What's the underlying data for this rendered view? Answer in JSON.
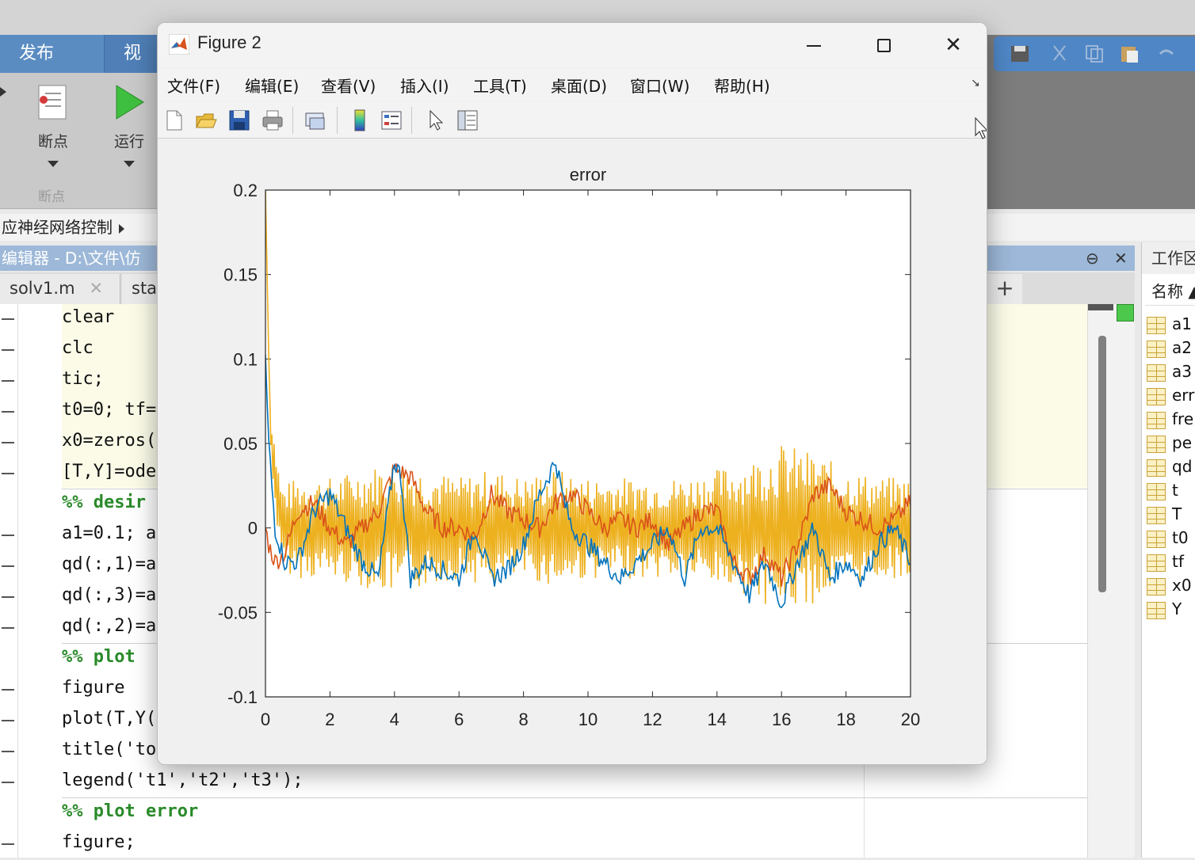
{
  "desktop": {
    "ribbon_tabs": [
      "发布",
      "视"
    ],
    "ribbon_buttons": [
      {
        "label": "断点",
        "icon": "breakpoint-icon"
      },
      {
        "label": "运行",
        "icon": "run-icon"
      }
    ],
    "ribbon_section": "断点",
    "breadcrumb": "应神经网络控制",
    "editor_title": "编辑器 - D:\\文件\\仿",
    "editor_tabs": [
      "solv1.m",
      "sta"
    ],
    "editor_lines": [
      {
        "text": "clear",
        "type": "code",
        "dash": true
      },
      {
        "text": "clc",
        "type": "code",
        "dash": true
      },
      {
        "text": "tic;",
        "type": "code",
        "dash": true
      },
      {
        "text": "t0=0; tf=",
        "type": "code",
        "dash": true
      },
      {
        "text": "x0=zeros(",
        "type": "code",
        "dash": true
      },
      {
        "text": "[T,Y]=ode",
        "type": "code",
        "dash": true
      },
      {
        "text": "%% desir",
        "type": "comment",
        "dash": false
      },
      {
        "text": "a1=0.1; a",
        "type": "code",
        "dash": true
      },
      {
        "text": "qd(:,1)=a",
        "type": "code",
        "dash": true
      },
      {
        "text": "qd(:,3)=a",
        "type": "code",
        "dash": true
      },
      {
        "text": "qd(:,2)=a",
        "type": "code",
        "dash": true
      },
      {
        "text": "%% plot",
        "type": "comment",
        "dash": false
      },
      {
        "text": "figure",
        "type": "code",
        "dash": true
      },
      {
        "text": "plot(T,Y(",
        "type": "code",
        "dash": true
      },
      {
        "text": "title('to",
        "type": "code",
        "dash": true
      },
      {
        "text": "legend('t1','t2','t3');",
        "type": "code",
        "dash": true
      },
      {
        "text": "%% plot error",
        "type": "comment",
        "dash": false
      },
      {
        "text": "figure;",
        "type": "code",
        "dash": true
      }
    ],
    "workspace_title": "工作区",
    "workspace_header": "名称 ▲",
    "workspace_vars": [
      "a1",
      "a2",
      "a3",
      "err",
      "fre",
      "pe",
      "qd",
      "t",
      "T",
      "t0",
      "tf",
      "x0",
      "Y"
    ]
  },
  "figure": {
    "title": "Figure 2",
    "menu": [
      "文件(F)",
      "编辑(E)",
      "查看(V)",
      "插入(I)",
      "工具(T)",
      "桌面(D)",
      "窗口(W)",
      "帮助(H)"
    ],
    "toolbar": [
      "new-figure-icon",
      "open-icon",
      "save-icon",
      "print-icon",
      "link-icon",
      "colorbar-icon",
      "legend-icon",
      "pointer-icon",
      "property-editor-icon"
    ]
  },
  "colors": {
    "series1": "#0072BD",
    "series2": "#D95319",
    "series3": "#EDB120"
  },
  "chart_data": {
    "type": "line",
    "title": "error",
    "xlabel": "",
    "ylabel": "",
    "xlim": [
      0,
      20
    ],
    "ylim": [
      -0.1,
      0.2
    ],
    "xticks": [
      0,
      2,
      4,
      6,
      8,
      10,
      12,
      14,
      16,
      18,
      20
    ],
    "yticks": [
      -0.1,
      -0.05,
      0,
      0.05,
      0.1,
      0.15,
      0.2
    ],
    "grid": false,
    "series": [
      {
        "color": "#0072BD",
        "x": [
          0,
          0.1,
          0.3,
          0.6,
          1,
          1.5,
          2,
          2.5,
          3,
          3.5,
          4,
          4.2,
          4.5,
          5,
          5.5,
          6,
          6.5,
          7,
          7.5,
          8,
          8.5,
          9,
          9.2,
          9.5,
          10,
          10.5,
          11,
          11.5,
          12,
          12.5,
          13,
          13.5,
          14,
          14.5,
          15,
          15.5,
          16,
          16.5,
          17,
          17.5,
          18,
          18.5,
          19,
          19.5,
          20
        ],
        "y": [
          0.1,
          0.05,
          0.0,
          -0.02,
          -0.02,
          0.01,
          0.02,
          0.0,
          -0.02,
          -0.03,
          0.04,
          0.03,
          -0.03,
          -0.02,
          -0.025,
          -0.03,
          0.0,
          -0.03,
          -0.025,
          -0.01,
          0.02,
          0.04,
          0.02,
          0.0,
          -0.01,
          -0.02,
          -0.03,
          -0.02,
          -0.01,
          0.0,
          -0.03,
          0.0,
          0.0,
          -0.02,
          -0.04,
          -0.02,
          -0.045,
          -0.02,
          0.0,
          -0.03,
          -0.02,
          -0.03,
          -0.01,
          0.0,
          -0.02
        ]
      },
      {
        "color": "#D95319",
        "x": [
          0,
          0.1,
          0.3,
          0.6,
          1,
          1.5,
          2,
          2.5,
          3,
          3.5,
          4,
          4.5,
          5,
          5.5,
          6,
          6.5,
          7,
          7.5,
          8,
          8.5,
          9,
          9.5,
          10,
          10.5,
          11,
          11.5,
          12,
          12.5,
          13,
          13.5,
          14,
          14.5,
          15,
          15.5,
          16,
          16.5,
          17,
          17.5,
          18,
          18.5,
          19,
          19.5,
          20
        ],
        "y": [
          0.0,
          -0.01,
          -0.02,
          -0.015,
          0.01,
          0.015,
          0.0,
          -0.01,
          0.0,
          0.01,
          0.035,
          0.03,
          0.01,
          0.0,
          0.0,
          -0.005,
          0.02,
          0.01,
          0.005,
          0.0,
          0.015,
          0.02,
          0.01,
          0.0,
          0.005,
          0.0,
          0.005,
          -0.01,
          0.0,
          0.01,
          0.01,
          -0.02,
          -0.03,
          -0.015,
          -0.03,
          -0.01,
          0.02,
          0.025,
          0.01,
          0.005,
          0.0,
          0.005,
          0.015
        ]
      },
      {
        "color": "#EDB120",
        "x": [
          0,
          0.05,
          0.15,
          0.3,
          0.5,
          1,
          2,
          3,
          4,
          5,
          6,
          7,
          8,
          9,
          10,
          11,
          12,
          13,
          14,
          15,
          15.5,
          16,
          17,
          18,
          19,
          20
        ],
        "y": [
          0.2,
          0.15,
          0.06,
          0.03,
          0.0,
          0.0,
          0.0,
          0.0,
          0.0,
          0.0,
          0.0,
          0.0,
          0.0,
          0.0,
          0.0,
          0.0,
          0.0,
          0.0,
          0.0,
          0.0,
          0.0,
          0.0,
          0.0,
          0.0,
          0.0,
          0.0
        ],
        "oscillation_amplitude": [
          0,
          0,
          0.01,
          0.02,
          0.025,
          0.03,
          0.03,
          0.035,
          0.04,
          0.035,
          0.03,
          0.035,
          0.03,
          0.035,
          0.03,
          0.03,
          0.03,
          0.03,
          0.035,
          0.04,
          0.045,
          0.05,
          0.045,
          0.035,
          0.03,
          0.03
        ]
      }
    ]
  }
}
